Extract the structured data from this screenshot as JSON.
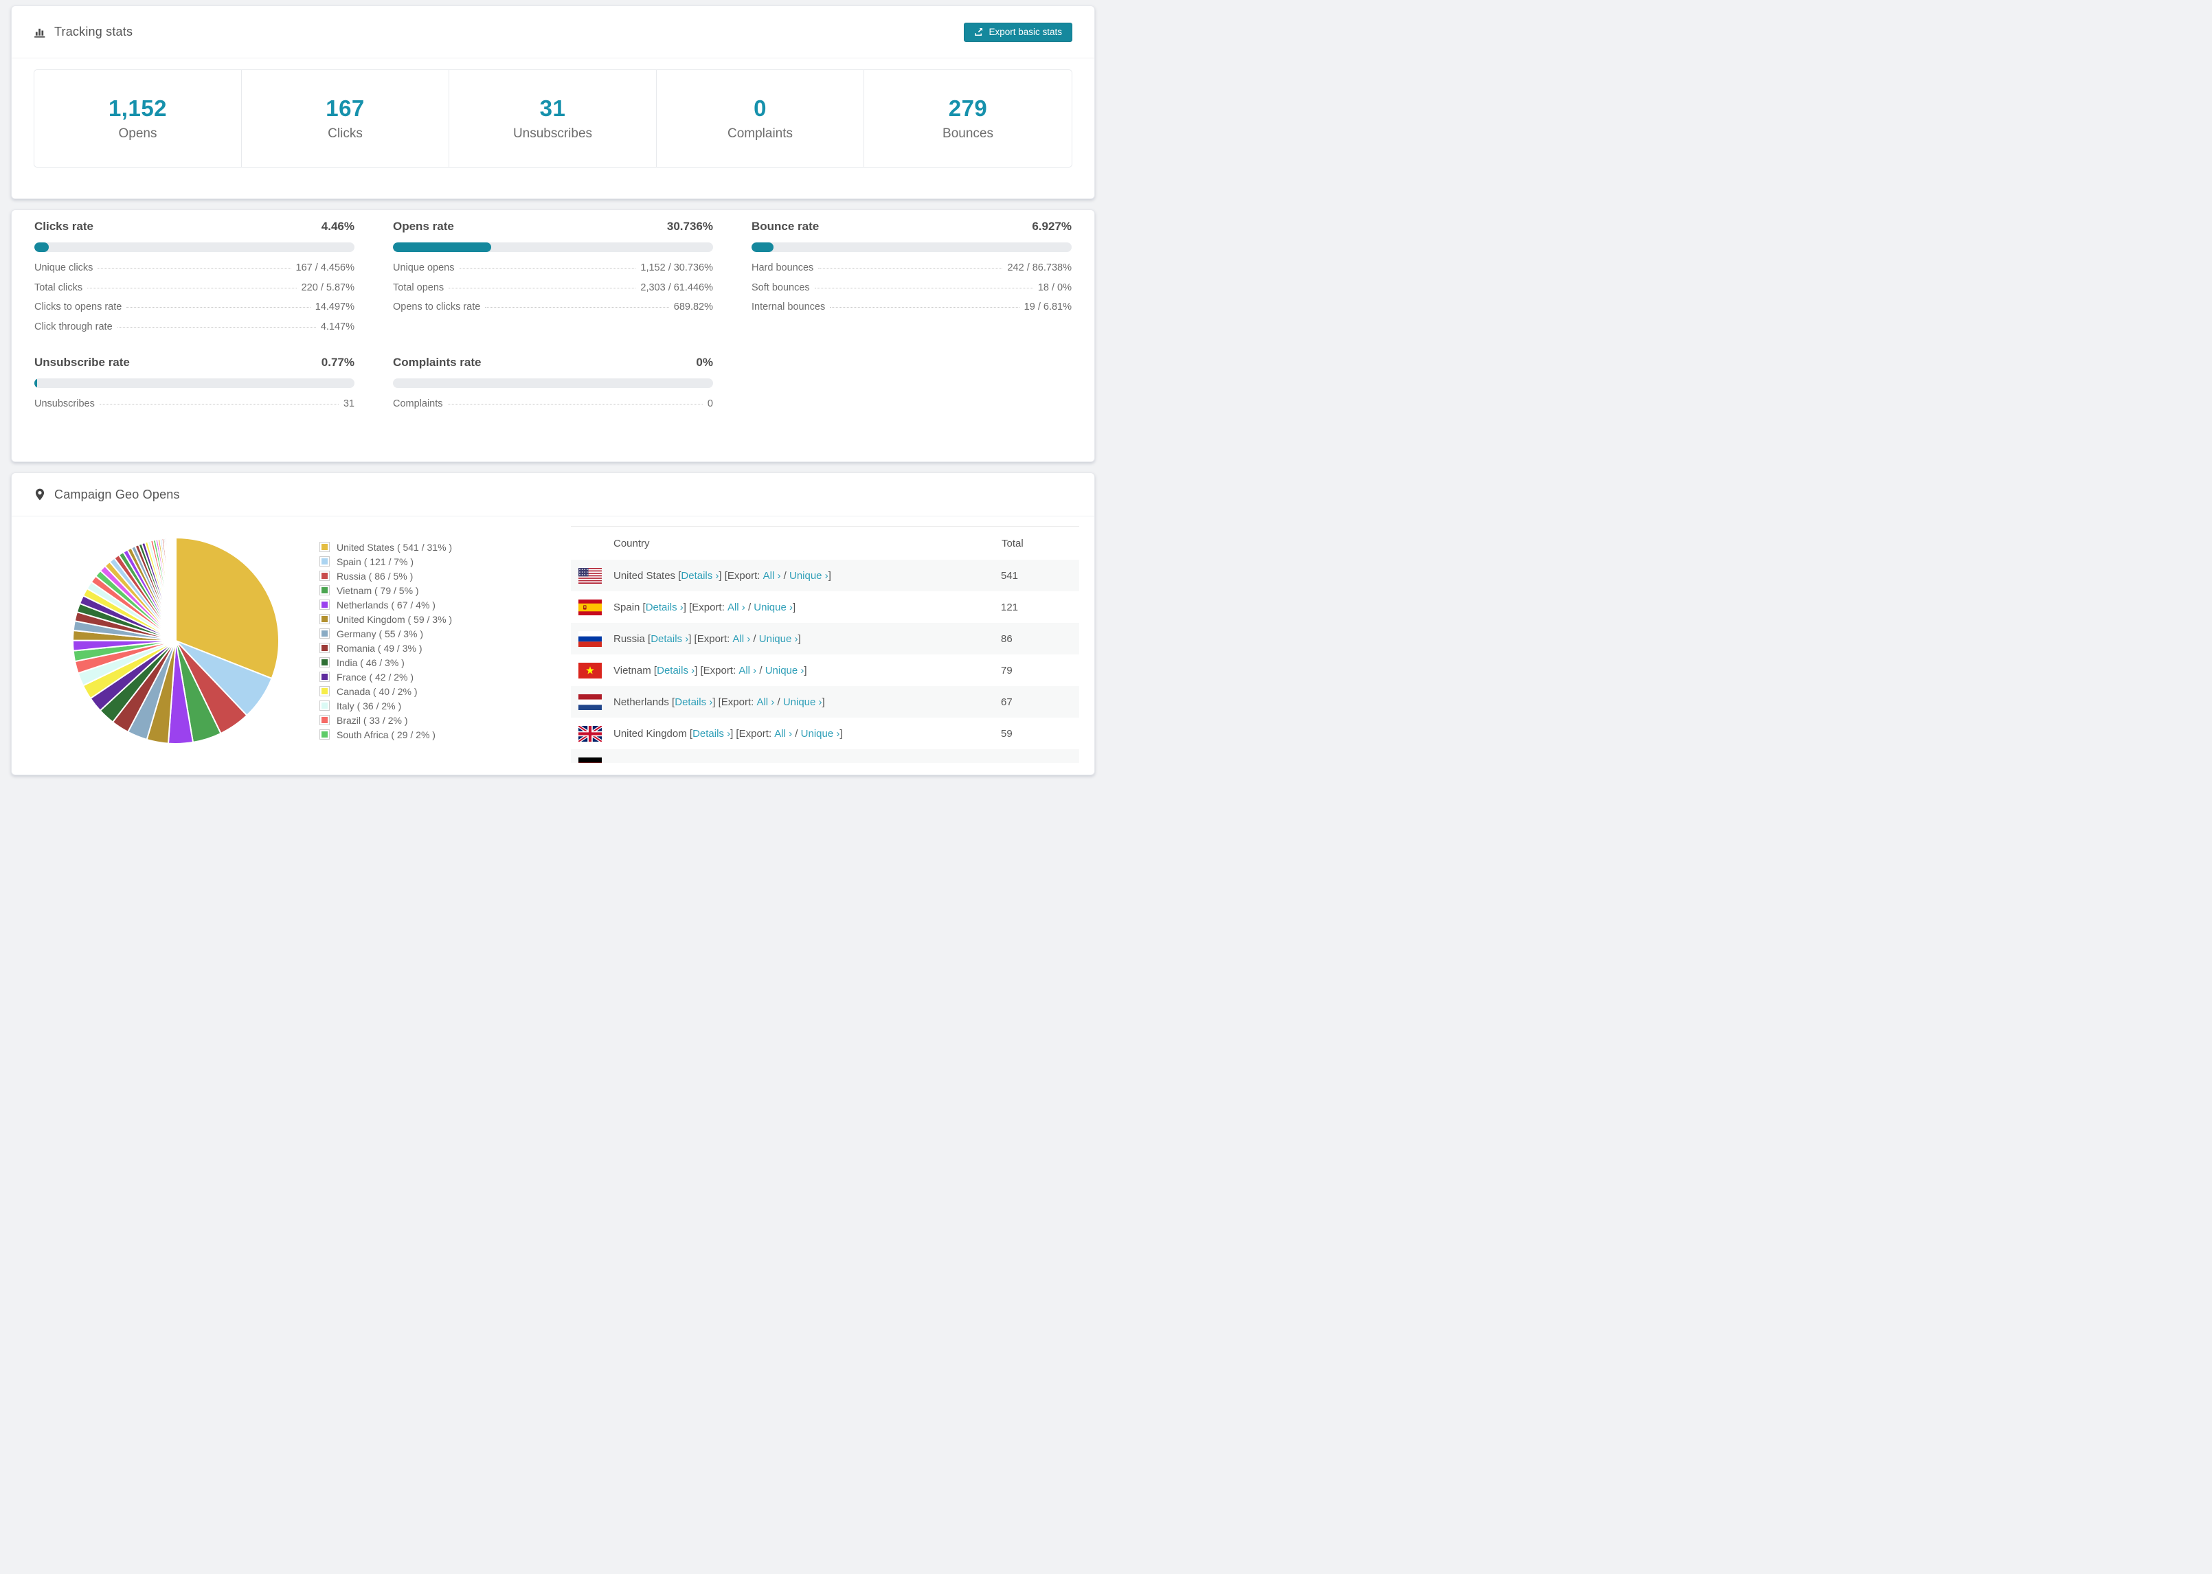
{
  "colors": {
    "accent": "#15889d",
    "stat_number": "#1691ac",
    "link": "#2f9fb8",
    "bar_background": "#e9ebee",
    "row_stripe": "#f7f8f8"
  },
  "tracking": {
    "title": "Tracking stats",
    "export_button": "Export basic stats",
    "stats": [
      {
        "value": "1,152",
        "label": "Opens"
      },
      {
        "value": "167",
        "label": "Clicks"
      },
      {
        "value": "31",
        "label": "Unsubscribes"
      },
      {
        "value": "0",
        "label": "Complaints"
      },
      {
        "value": "279",
        "label": "Bounces"
      }
    ]
  },
  "rates": [
    {
      "title": "Clicks rate",
      "value": "4.46%",
      "percent": 4.46,
      "rows": [
        {
          "label": "Unique clicks",
          "value": "167 / 4.456%"
        },
        {
          "label": "Total clicks",
          "value": "220 / 5.87%"
        },
        {
          "label": "Clicks to opens rate",
          "value": "14.497%"
        },
        {
          "label": "Click through rate",
          "value": "4.147%"
        }
      ]
    },
    {
      "title": "Opens rate",
      "value": "30.736%",
      "percent": 30.736,
      "rows": [
        {
          "label": "Unique opens",
          "value": "1,152 / 30.736%"
        },
        {
          "label": "Total opens",
          "value": "2,303 / 61.446%"
        },
        {
          "label": "Opens to clicks rate",
          "value": "689.82%"
        }
      ]
    },
    {
      "title": "Bounce rate",
      "value": "6.927%",
      "percent": 6.927,
      "rows": [
        {
          "label": "Hard bounces",
          "value": "242 / 86.738%"
        },
        {
          "label": "Soft bounces",
          "value": "18 / 0%"
        },
        {
          "label": "Internal bounces",
          "value": "19 / 6.81%"
        }
      ]
    },
    {
      "title": "Unsubscribe rate",
      "value": "0.77%",
      "percent": 0.77,
      "rows": [
        {
          "label": "Unsubscribes",
          "value": "31"
        }
      ]
    },
    {
      "title": "Complaints rate",
      "value": "0%",
      "percent": 0,
      "rows": [
        {
          "label": "Complaints",
          "value": "0"
        }
      ]
    }
  ],
  "geo": {
    "title": "Campaign Geo Opens",
    "legend": [
      {
        "label": "United States ( 541 / 31% )",
        "color": "#e4bd41"
      },
      {
        "label": "Spain ( 121 / 7% )",
        "color": "#abd4f1"
      },
      {
        "label": "Russia ( 86 / 5% )",
        "color": "#c84b4b"
      },
      {
        "label": "Vietnam ( 79 / 5% )",
        "color": "#4ba551"
      },
      {
        "label": "Netherlands ( 67 / 4% )",
        "color": "#9b42ee"
      },
      {
        "label": "United Kingdom ( 59 / 3% )",
        "color": "#b2902f"
      },
      {
        "label": "Germany ( 55 / 3% )",
        "color": "#8aabc4"
      },
      {
        "label": "Romania ( 49 / 3% )",
        "color": "#9c3b38"
      },
      {
        "label": "India ( 46 / 3% )",
        "color": "#2e6f34"
      },
      {
        "label": "France ( 42 / 2% )",
        "color": "#5e2b9d"
      },
      {
        "label": "Canada ( 40 / 2% )",
        "color": "#f6ed49"
      },
      {
        "label": "Italy ( 36 / 2% )",
        "color": "#dbfaf5"
      },
      {
        "label": "Brazil ( 33 / 2% )",
        "color": "#f66a66"
      },
      {
        "label": "South Africa ( 29 / 2% )",
        "color": "#5ecb67"
      }
    ],
    "table": {
      "columns": {
        "country": "Country",
        "total": "Total"
      },
      "link_labels": {
        "details": "Details ›",
        "export_prefix": "Export:",
        "all": "All ›",
        "unique": "Unique ›"
      },
      "punct": {
        "open_bracket": "[",
        "close_bracket": "]",
        "separator": "/"
      },
      "rows": [
        {
          "flag": "us",
          "country": "United States",
          "total": "541"
        },
        {
          "flag": "es",
          "country": "Spain",
          "total": "121"
        },
        {
          "flag": "ru",
          "country": "Russia",
          "total": "86"
        },
        {
          "flag": "vn",
          "country": "Vietnam",
          "total": "79"
        },
        {
          "flag": "nl",
          "country": "Netherlands",
          "total": "67"
        },
        {
          "flag": "gb",
          "country": "United Kingdom",
          "total": "59"
        },
        {
          "flag": "de",
          "country": "",
          "total": ""
        }
      ]
    }
  },
  "chart_data": {
    "type": "pie",
    "title": "Campaign Geo Opens",
    "legend_position": "right",
    "labels": [
      "United States",
      "Spain",
      "Russia",
      "Vietnam",
      "Netherlands",
      "United Kingdom",
      "Germany",
      "Romania",
      "India",
      "France",
      "Canada",
      "Italy",
      "Brazil",
      "South Africa"
    ],
    "values": [
      541,
      121,
      86,
      79,
      67,
      59,
      55,
      49,
      46,
      42,
      40,
      36,
      33,
      29
    ],
    "percents": [
      31,
      7,
      5,
      5,
      4,
      3,
      3,
      3,
      3,
      2,
      2,
      2,
      2,
      2
    ],
    "colors": [
      "#e4bd41",
      "#abd4f1",
      "#c84b4b",
      "#4ba551",
      "#9b42ee",
      "#b2902f",
      "#8aabc4",
      "#9c3b38",
      "#2e6f34",
      "#5e2b9d",
      "#f6ed49",
      "#dbfaf5",
      "#f66a66",
      "#5ecb67"
    ],
    "other_values": [
      28,
      27,
      26,
      25,
      24,
      23,
      22,
      21,
      20,
      19,
      18,
      17,
      16,
      15,
      14,
      13,
      12,
      11,
      10,
      9,
      9,
      8,
      8,
      7,
      7,
      6,
      6,
      5,
      5,
      4,
      4,
      3,
      3,
      3,
      2,
      2,
      2,
      2,
      1,
      1,
      1,
      1,
      1,
      1,
      1,
      1
    ],
    "start_angle_deg": -90,
    "direction": "clockwise"
  }
}
